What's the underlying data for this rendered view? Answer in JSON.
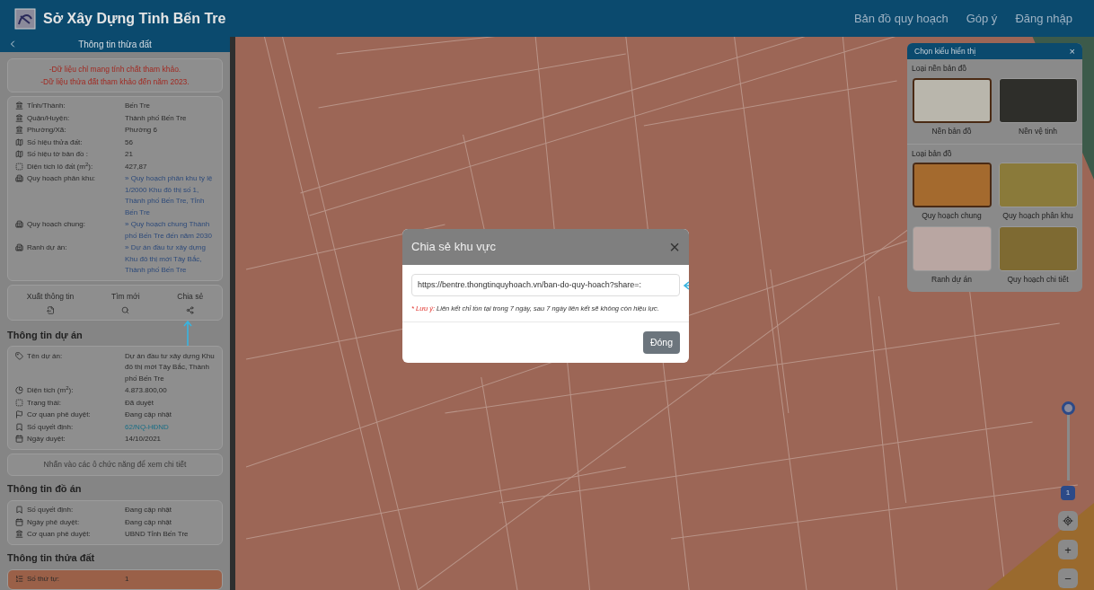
{
  "header": {
    "title": "Sở Xây Dựng Tỉnh Bến Tre",
    "nav": [
      "Bản đồ quy hoạch",
      "Góp ý",
      "Đăng nhập"
    ]
  },
  "sidebar": {
    "title": "Thông tin thừa đất",
    "notices": [
      "-Dữ liệu chỉ mang tính chất tham khảo.",
      "-Dữ liệu thửa đất tham khảo đến năm 2023."
    ],
    "parcel_rows": [
      {
        "label": "Tỉnh/Thành:",
        "value": "Bến Tre",
        "kind": "text"
      },
      {
        "label": "Quận/Huyện:",
        "value": "Thành phố Bến Tre",
        "kind": "text"
      },
      {
        "label": "Phường/Xã:",
        "value": "Phường 6",
        "kind": "text"
      },
      {
        "label": "Số hiệu thửa đất:",
        "value": "56",
        "kind": "text"
      },
      {
        "label": "Số hiệu tờ bản đồ :",
        "value": "21",
        "kind": "text"
      },
      {
        "label": "Diện tích lô đất (m$^{2}$):",
        "value": "427,87",
        "kind": "text"
      },
      {
        "label": "Quy hoạch phân khu:",
        "value": "»  Quy hoạch phân khu tỷ lệ 1/2000 Khu đô thị số 1, Thành phố Bến Tre, Tỉnh Bến Tre",
        "kind": "link"
      },
      {
        "label": "Quy hoạch chung:",
        "value": "»  Quy hoạch chung Thành phố Bến Tre đến năm 2030",
        "kind": "link"
      },
      {
        "label": "Ranh dự án:",
        "value": "»  Dự án đầu tư xây dựng Khu đô thị mới Tây Bắc, Thành phố Bến Tre",
        "kind": "link"
      }
    ],
    "actions": [
      "Xuất thông tin",
      "Tìm mới",
      "Chia sẻ"
    ],
    "project_heading": "Thông tin dự án",
    "project_rows": [
      {
        "label": "Tên dự án:",
        "value": "Dự án đầu tư xây dựng Khu đô thị mới Tây Bắc, Thành phố Bến Tre",
        "kind": "text"
      },
      {
        "label": "Diện tích (m$^{2}$):",
        "value": "4.873.800,00",
        "kind": "text"
      },
      {
        "label": "Trạng thái:",
        "value": "Đã duyệt",
        "kind": "text"
      },
      {
        "label": "Cơ quan phê duyệt:",
        "value": "Đang cập nhật",
        "kind": "text"
      },
      {
        "label": "Số quyết định:",
        "value": "62/NQ-HĐND",
        "kind": "link"
      },
      {
        "label": "Ngày duyệt:",
        "value": "14/10/2021",
        "kind": "text"
      }
    ],
    "hint": "Nhấn vào các ô chức năng để xem chi tiết",
    "plan_heading": "Thông tin đồ án",
    "plan_rows": [
      {
        "label": "Số quyết định:",
        "value": "Đang cập nhật",
        "kind": "text"
      },
      {
        "label": "Ngày phê duyệt:",
        "value": "Đang cập nhật",
        "kind": "text"
      },
      {
        "label": "Cơ quan phê duyệt:",
        "value": "UBND Tỉnh Bến Tre",
        "kind": "text"
      }
    ],
    "land_heading": "Thông tin thửa đất",
    "land_rows": [
      {
        "label": "Số thứ tự:",
        "value": "1",
        "kind": "text"
      }
    ]
  },
  "layer_panel": {
    "title": "Chọn kiểu hiển thị",
    "close": "×",
    "groups": [
      {
        "title": "Loại nền bản đồ",
        "options": [
          {
            "label": "Nền bản đồ",
            "selected": true
          },
          {
            "label": "Nền vệ tinh",
            "selected": false
          }
        ]
      },
      {
        "title": "Loại bản đồ",
        "options": [
          {
            "label": "Quy hoạch chung",
            "selected": true
          },
          {
            "label": "Quy hoạch phân khu",
            "selected": false
          },
          {
            "label": "Ranh dự án",
            "selected": false
          },
          {
            "label": "Quy hoạch chi tiết",
            "selected": false
          }
        ]
      }
    ]
  },
  "opacity_slider": {
    "level": 1,
    "reading": "1"
  },
  "zoom_controls": [
    "+",
    "−"
  ],
  "dialog": {
    "title": "Chia sẻ khu vực",
    "close": "×",
    "link": "https://bentre.thongtinquyhoach.vn/ban-do-quy-hoach?share=:",
    "note_label": "* Lưu ý:",
    "note": "Liên kết chỉ tồn tại trong 7 ngày, sau 7 ngày liên kết sẽ không còn hiệu lực.",
    "button": "Đóng"
  }
}
